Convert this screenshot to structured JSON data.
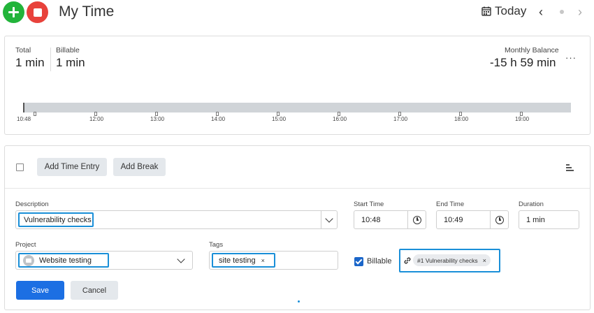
{
  "header": {
    "title": "My Time",
    "today_label": "Today",
    "prev": "‹",
    "next": "›"
  },
  "summary": {
    "total_label": "Total",
    "total_value": "1 min",
    "billable_label": "Billable",
    "billable_value": "1 min",
    "balance_label": "Monthly Balance",
    "balance_value": "-15 h 59 min",
    "more": "···"
  },
  "timeline": {
    "ticks": [
      "10:48",
      "12:00",
      "13:00",
      "14:00",
      "15:00",
      "16:00",
      "17:00",
      "18:00",
      "19:00"
    ]
  },
  "toolbar": {
    "add_time_entry": "Add Time Entry",
    "add_break": "Add Break"
  },
  "form": {
    "description_label": "Description",
    "description_value": "Vulnerability checks",
    "start_label": "Start Time",
    "start_value": "10:48",
    "end_label": "End Time",
    "end_value": "10:49",
    "duration_label": "Duration",
    "duration_value": "1 min",
    "project_label": "Project",
    "project_value": "Website testing",
    "tags_label": "Tags",
    "tag_value": "site testing",
    "tag_remove": "×",
    "billable_label": "Billable",
    "billable_checked": true,
    "link_value": "#1 Vulnerability checks",
    "link_remove": "×",
    "save": "Save",
    "cancel": "Cancel"
  },
  "colors": {
    "add": "#22b43a",
    "stop": "#e8423b",
    "primary": "#1c6fe3",
    "highlight": "#1a8fd8"
  },
  "icons": [
    "plus-icon",
    "stop-icon",
    "calendar-icon",
    "chevron-left-icon",
    "chevron-right-icon",
    "more-icon",
    "sort-icon",
    "chevron-down-icon",
    "clock-icon",
    "folder-icon",
    "link-icon",
    "close-icon",
    "check-icon"
  ]
}
